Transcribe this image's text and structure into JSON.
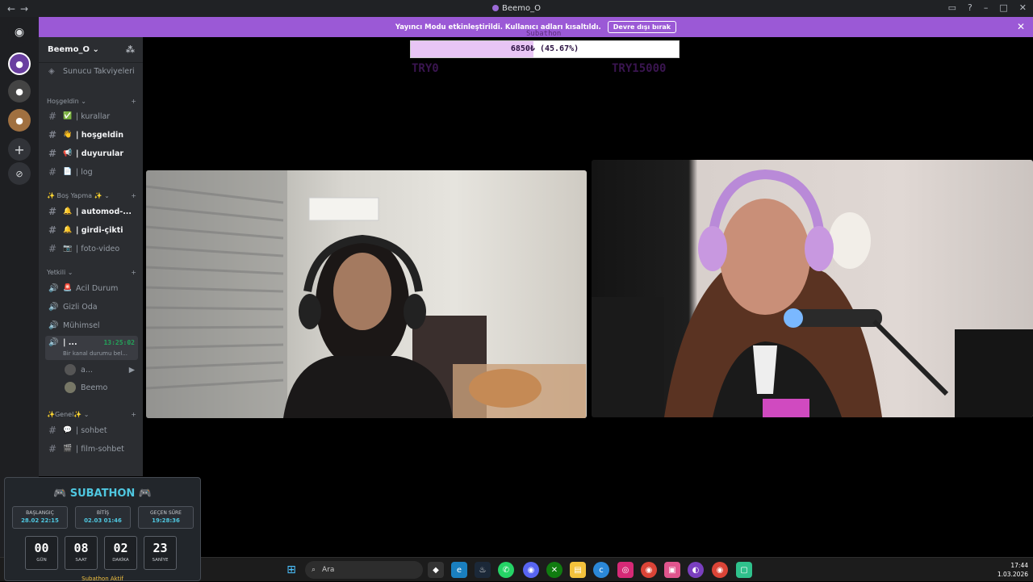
{
  "window": {
    "title": "Beemo_O"
  },
  "banner": {
    "text": "Yayıncı Modu etkinleştirildi. Kullanıcı adları kısaltıldı.",
    "button": "Devre dışı bırak"
  },
  "server": {
    "name": "Beemo_O",
    "boosts": "Sunucu Takviyeleri"
  },
  "categories": {
    "welcome": "Hoşgeldin",
    "bos": "✨ Boş Yapma ✨",
    "yetkili": "Yetkili",
    "genel": "✨Genel✨"
  },
  "channels": [
    {
      "emoji": "✅",
      "name": "| kurallar"
    },
    {
      "emoji": "👋",
      "name": "| hoşgeldin"
    },
    {
      "emoji": "📢",
      "name": "| duyurular"
    },
    {
      "emoji": "📄",
      "name": "| log"
    },
    {
      "emoji": "🔔",
      "name": "| automod-..."
    },
    {
      "emoji": "🔔",
      "name": "| girdi-çikti"
    },
    {
      "emoji": "📷",
      "name": "| foto-video"
    },
    {
      "emoji": "🚨",
      "name": "Acil Durum"
    },
    {
      "emoji": "",
      "name": "Gizli Oda"
    },
    {
      "emoji": "",
      "name": "Mühimsel"
    },
    {
      "emoji": "",
      "name": "| ..."
    },
    {
      "emoji": "💬",
      "name": "| sohbet"
    },
    {
      "emoji": "🎬",
      "name": "| film-sohbet"
    }
  ],
  "voice": {
    "time": "13:25:02",
    "status": "Bir kanal durumu bel...",
    "users": [
      "a...",
      "Beemo"
    ]
  },
  "stream": {
    "subtitle": "Subathon",
    "progress_text": "6850₺ (45.67%)",
    "progress": 0.4567,
    "min": "TRY0",
    "max": "TRY15000"
  },
  "subathon": {
    "title": "SUBATHON",
    "start_label": "BAŞLANGIÇ",
    "start": "28.02 22:15",
    "end_label": "BİTİŞ",
    "end": "02.03 01:46",
    "elapsed_label": "GEÇEN SÜRE",
    "elapsed": "19:28:36",
    "days": "00",
    "days_u": "GÜN",
    "hours": "08",
    "hours_u": "SAAT",
    "mins": "02",
    "mins_u": "DAKİKA",
    "secs": "23",
    "secs_u": "SANİYE",
    "active": "Subathon Aktif"
  },
  "taskbar": {
    "search": "Ara",
    "time": "17:44",
    "date": "1.03.2026"
  }
}
